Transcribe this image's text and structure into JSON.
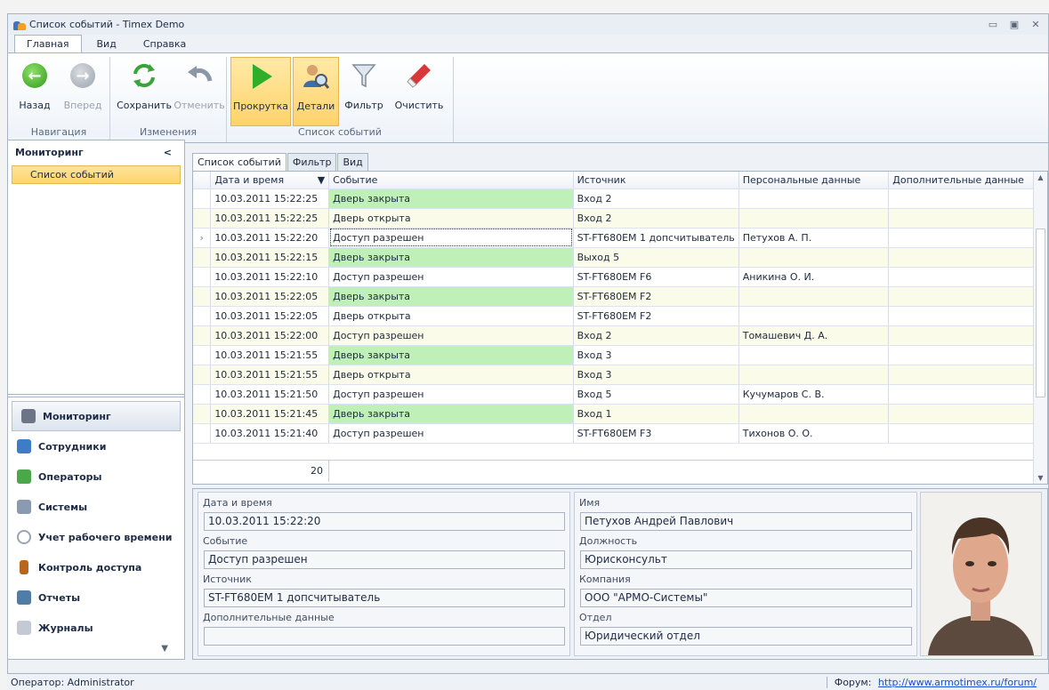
{
  "window": {
    "title": "Список событий - Timex Demo"
  },
  "menu_tabs": [
    "Главная",
    "Вид",
    "Справка"
  ],
  "ribbon": {
    "groups": [
      {
        "label": "Навигация",
        "buttons": [
          "Назад",
          "Вперед"
        ]
      },
      {
        "label": "Изменения",
        "buttons": [
          "Сохранить",
          "Отменить"
        ]
      },
      {
        "label": "Список событий",
        "buttons": [
          "Прокрутка",
          "Детали",
          "Фильтр",
          "Очистить"
        ]
      }
    ]
  },
  "sidebar": {
    "header": "Мониторинг",
    "collapse_glyph": "<",
    "selected_item": "Список событий",
    "nav": [
      {
        "label": "Мониторинг",
        "icon": "monitor-icon",
        "color": "#6b7585"
      },
      {
        "label": "Сотрудники",
        "icon": "employees-icon",
        "color": "#3f7cc8"
      },
      {
        "label": "Операторы",
        "icon": "operators-icon",
        "color": "#4aa84a"
      },
      {
        "label": "Системы",
        "icon": "systems-icon",
        "color": "#8a9bb0"
      },
      {
        "label": "Учет рабочего времени",
        "icon": "clock-icon",
        "color": "#9aa3b0"
      },
      {
        "label": "Контроль доступа",
        "icon": "door-icon",
        "color": "#b8661e"
      },
      {
        "label": "Отчеты",
        "icon": "reports-icon",
        "color": "#4f7da8"
      },
      {
        "label": "Журналы",
        "icon": "journals-icon",
        "color": "#c4cad3"
      }
    ]
  },
  "content_tabs": [
    "Список событий",
    "Фильтр",
    "Вид"
  ],
  "grid": {
    "columns": [
      "Дата и время",
      "Событие",
      "Источник",
      "Персональные данные",
      "Дополнительные данные"
    ],
    "rows": [
      {
        "time": "10.03.2011 15:22:25",
        "event": "Дверь закрыта",
        "source": "Вход 2",
        "person": "",
        "extra": "",
        "green": true
      },
      {
        "time": "10.03.2011 15:22:25",
        "event": "Дверь открыта",
        "source": "Вход 2",
        "person": "",
        "extra": "",
        "green": false
      },
      {
        "time": "10.03.2011 15:22:20",
        "event": "Доступ разрешен",
        "source": "ST-FT680EM 1 допсчитыватель",
        "person": "Петухов А. П.",
        "extra": "",
        "green": false,
        "current": true
      },
      {
        "time": "10.03.2011 15:22:15",
        "event": "Дверь закрыта",
        "source": "Выход 5",
        "person": "",
        "extra": "",
        "green": true
      },
      {
        "time": "10.03.2011 15:22:10",
        "event": "Доступ разрешен",
        "source": "ST-FT680EM F6",
        "person": "Аникина О. И.",
        "extra": "",
        "green": false
      },
      {
        "time": "10.03.2011 15:22:05",
        "event": "Дверь закрыта",
        "source": "ST-FT680EM F2",
        "person": "",
        "extra": "",
        "green": true
      },
      {
        "time": "10.03.2011 15:22:05",
        "event": "Дверь открыта",
        "source": "ST-FT680EM F2",
        "person": "",
        "extra": "",
        "green": false
      },
      {
        "time": "10.03.2011 15:22:00",
        "event": "Доступ разрешен",
        "source": "Вход 2",
        "person": "Томашевич Д. А.",
        "extra": "",
        "green": false
      },
      {
        "time": "10.03.2011 15:21:55",
        "event": "Дверь закрыта",
        "source": "Вход 3",
        "person": "",
        "extra": "",
        "green": true
      },
      {
        "time": "10.03.2011 15:21:55",
        "event": "Дверь открыта",
        "source": "Вход 3",
        "person": "",
        "extra": "",
        "green": false
      },
      {
        "time": "10.03.2011 15:21:50",
        "event": "Доступ разрешен",
        "source": "Вход 5",
        "person": "Кучумаров С. В.",
        "extra": "",
        "green": false
      },
      {
        "time": "10.03.2011 15:21:45",
        "event": "Дверь закрыта",
        "source": "Вход 1",
        "person": "",
        "extra": "",
        "green": true
      },
      {
        "time": "10.03.2011 15:21:40",
        "event": "Доступ разрешен",
        "source": "ST-FT680EM F3",
        "person": "Тихонов О. О.",
        "extra": "",
        "green": false
      }
    ],
    "total": "20"
  },
  "details": {
    "left": [
      {
        "label": "Дата и время",
        "value": "10.03.2011 15:22:20"
      },
      {
        "label": "Событие",
        "value": "Доступ разрешен"
      },
      {
        "label": "Источник",
        "value": "ST-FT680EM 1 допсчитыватель"
      },
      {
        "label": "Дополнительные данные",
        "value": ""
      }
    ],
    "right": [
      {
        "label": "Имя",
        "value": "Петухов Андрей Павлович"
      },
      {
        "label": "Должность",
        "value": "Юрисконсульт"
      },
      {
        "label": "Компания",
        "value": "ООО \"АРМО-Системы\""
      },
      {
        "label": "Отдел",
        "value": "Юридический отдел"
      }
    ]
  },
  "status": {
    "operator": "Оператор: Administrator",
    "forum_label": "Форум:",
    "forum_link": "http://www.armotimex.ru/forum/"
  }
}
